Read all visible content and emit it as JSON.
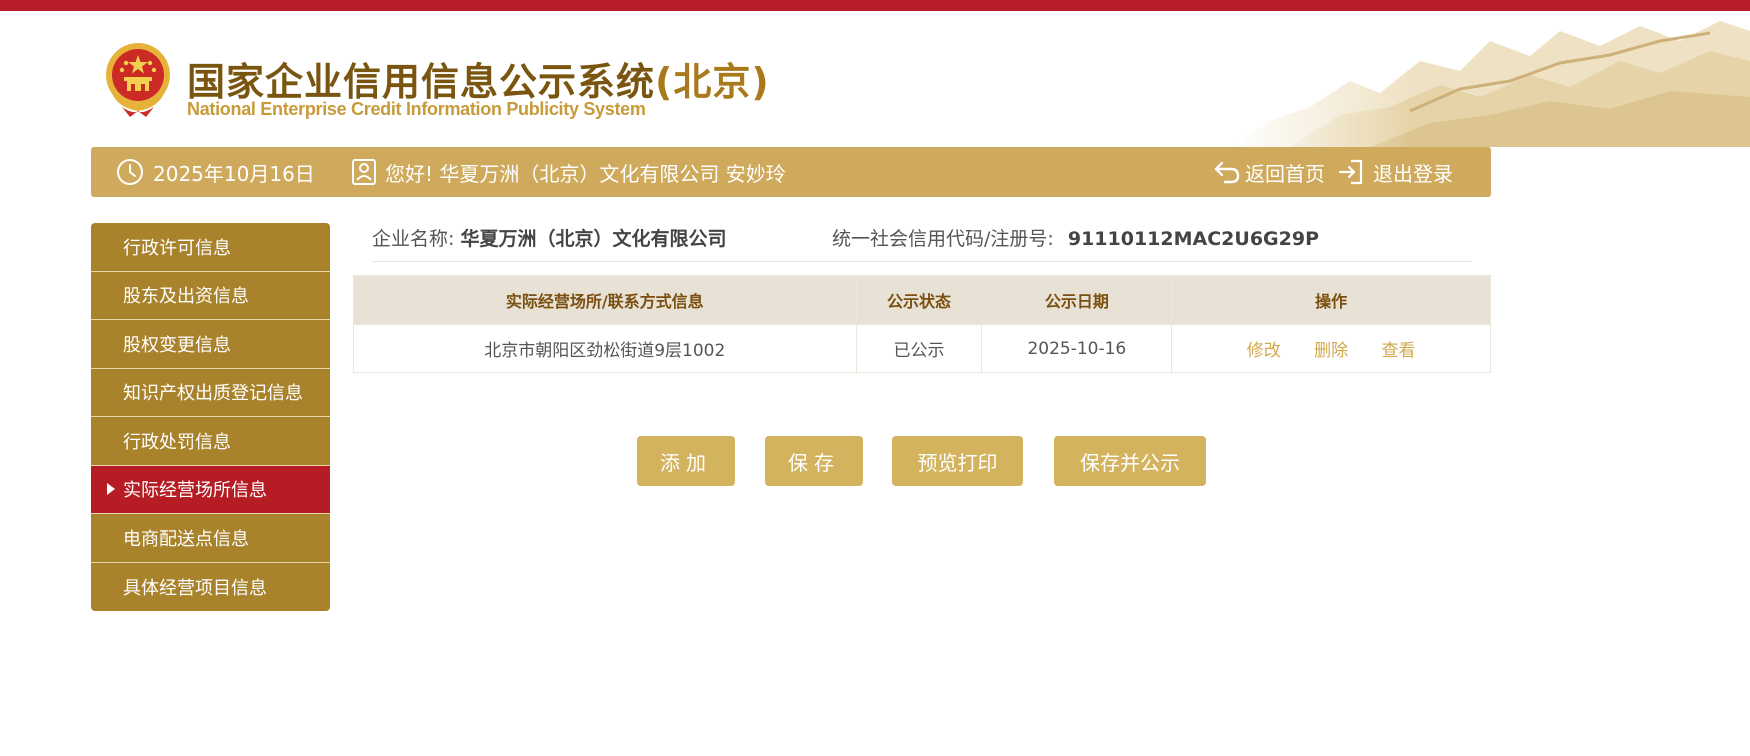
{
  "header": {
    "title_cn": "国家企业信用信息公示系统",
    "title_region": "(北京)",
    "title_en": "National Enterprise Credit Information Publicity System"
  },
  "toolbar": {
    "date": "2025年10月16日",
    "greeting": "您好!  华夏万洲（北京）文化有限公司  安妙玲",
    "home_label": "返回首页",
    "logout_label": "退出登录"
  },
  "sidebar": {
    "items": [
      {
        "label": "行政许可信息",
        "active": false
      },
      {
        "label": "股东及出资信息",
        "active": false
      },
      {
        "label": "股权变更信息",
        "active": false
      },
      {
        "label": "知识产权出质登记信息",
        "active": false
      },
      {
        "label": "行政处罚信息",
        "active": false
      },
      {
        "label": "实际经营场所信息",
        "active": true
      },
      {
        "label": "电商配送点信息",
        "active": false
      },
      {
        "label": "具体经营项目信息",
        "active": false
      }
    ]
  },
  "company": {
    "name_label": "企业名称:",
    "name_value": "华夏万洲（北京）文化有限公司",
    "code_label": "统一社会信用代码/注册号:",
    "code_value": "91110112MAC2U6G29P"
  },
  "table": {
    "headers": [
      "实际经营场所/联系方式信息",
      "公示状态",
      "公示日期",
      "操作"
    ],
    "rows": [
      {
        "address": "北京市朝阳区劲松街道9层1002",
        "status": "已公示",
        "date": "2025-10-16",
        "ops": [
          "修改",
          "删除",
          "查看"
        ]
      }
    ]
  },
  "buttons": {
    "add": "添加",
    "save": "保存",
    "preview": "预览打印",
    "publish": "保存并公示"
  },
  "colors": {
    "top_bar": "#b71c2b",
    "toolbar": "#cfa95c",
    "sidebar": "#a9822c",
    "sidebar_active": "#b61c23",
    "button": "#d4b35e",
    "title": "#7a5510"
  }
}
